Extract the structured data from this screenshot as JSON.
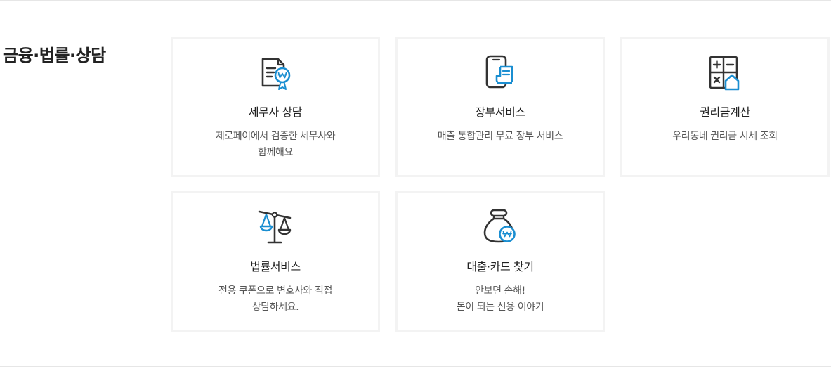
{
  "section": {
    "title": "금융·법률·상담"
  },
  "colors": {
    "icon_dark": "#333333",
    "icon_accent": "#1a8ed1",
    "card_border": "#f3f3f3",
    "title_text": "#222222",
    "desc_text": "#555555"
  },
  "cards": [
    {
      "icon": "certificate-won-icon",
      "title": "세무사 상담",
      "desc": "제로페이에서 검증한 세무사와\n함께해요"
    },
    {
      "icon": "phone-receipt-icon",
      "title": "장부서비스",
      "desc": "매출 통합관리 무료 장부 서비스"
    },
    {
      "icon": "calculator-house-icon",
      "title": "권리금계산",
      "desc": "우리동네 권리금 시세 조회"
    },
    {
      "icon": "scale-icon",
      "title": "법률서비스",
      "desc": "전용 쿠폰으로 변호사와 직접\n상담하세요."
    },
    {
      "icon": "money-bag-won-icon",
      "title": "대출·카드 찾기",
      "desc": "안보면 손해!\n돈이 되는 신용 이야기"
    }
  ]
}
